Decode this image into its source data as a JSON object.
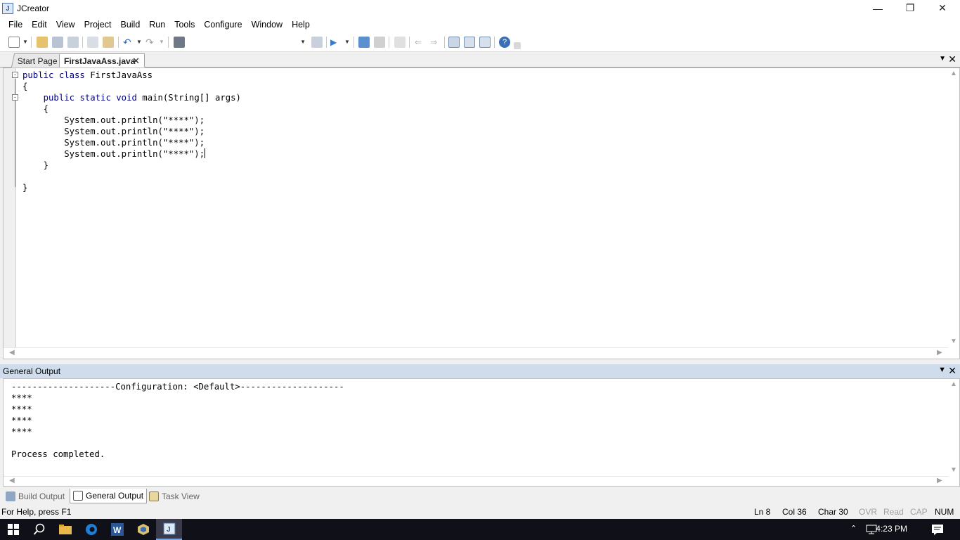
{
  "window": {
    "title": "JCreator"
  },
  "menu": [
    "File",
    "Edit",
    "View",
    "Project",
    "Build",
    "Run",
    "Tools",
    "Configure",
    "Window",
    "Help"
  ],
  "doc_tabs": {
    "start": "Start Page",
    "active": "FirstJavaAss.java"
  },
  "editor": {
    "lines": [
      "public class FirstJavaAss",
      "{",
      "    public static void main(String[] args)",
      "    {",
      "        System.out.println(\"****\");",
      "        System.out.println(\"****\");",
      "        System.out.println(\"****\");",
      "        System.out.println(\"****\");",
      "    }",
      "",
      "}"
    ]
  },
  "output_panel": {
    "title": "General Output",
    "lines": [
      "--------------------Configuration: <Default>--------------------",
      "****",
      "****",
      "****",
      "****",
      "",
      "Process completed."
    ]
  },
  "bottom_tabs": [
    "Build Output",
    "General Output",
    "Task View"
  ],
  "status": {
    "help": "For Help, press F1",
    "ln": "Ln 8",
    "col": "Col 36",
    "char": "Char 30",
    "ovr": "OVR",
    "read": "Read",
    "cap": "CAP",
    "num": "NUM"
  },
  "taskbar": {
    "time": "4:23 PM"
  },
  "colors": {
    "keyword": "#00007f",
    "panel_header": "#cfdcec",
    "taskbar": "#101018"
  }
}
